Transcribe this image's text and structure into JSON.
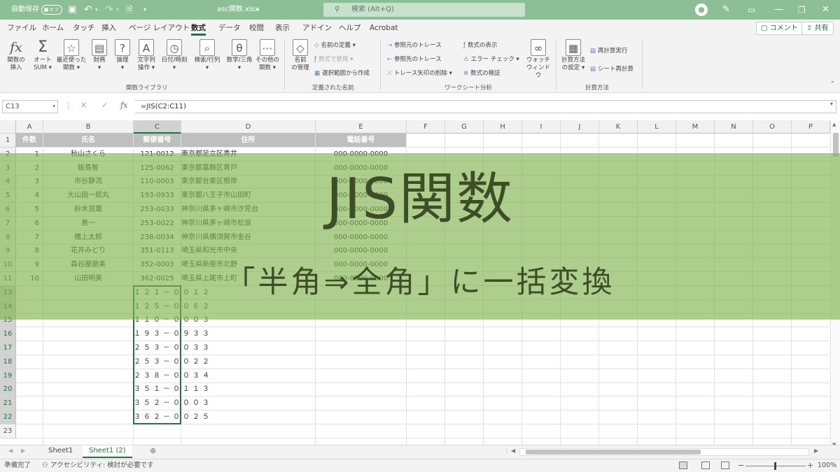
{
  "titlebar": {
    "autosave_label": "自動保存",
    "autosave_state": "オフ",
    "filename": "asc関数.xlsx",
    "search_placeholder": "検索 (Alt+Q)"
  },
  "menu": [
    "ファイル",
    "ホーム",
    "タッチ",
    "挿入",
    "ページ レイアウト",
    "数式",
    "データ",
    "校閲",
    "表示",
    "アドイン",
    "ヘルプ",
    "Acrobat"
  ],
  "menu_active": "数式",
  "comment_button": "コメント",
  "share_button": "共有",
  "ribbon": {
    "insert_function": [
      "関数の",
      "挿入"
    ],
    "autosum": [
      "オート",
      "SUM"
    ],
    "recent": [
      "最近使った",
      "関数"
    ],
    "financial": "財務",
    "logical": "論理",
    "text": [
      "文字列",
      "操作"
    ],
    "datetime": "日付/時刻",
    "lookup": "検索/行列",
    "math": "数学/三角",
    "more": [
      "その他の",
      "関数"
    ],
    "group_library": "関数ライブラリ",
    "name_manager": [
      "名前",
      "の管理"
    ],
    "define_name": "名前の定義",
    "use_in_formula": "数式で使用",
    "create_from_selection": "選択範囲から作成",
    "group_names": "定義された名前",
    "trace_precedents": "参照元のトレース",
    "trace_dependents": "参照先のトレース",
    "remove_arrows": "トレース矢印の削除",
    "show_formulas": "数式の表示",
    "error_check": "エラー チェック",
    "evaluate": "数式の検証",
    "watch": [
      "ウォッチ",
      "ウィンドウ"
    ],
    "group_audit": "ワークシート分析",
    "calc_options": [
      "計算方法",
      "の設定"
    ],
    "calc_now": "再計算実行",
    "calc_sheet": "シート再計算",
    "group_calc": "計算方法"
  },
  "formula_bar": {
    "name_box": "C13",
    "formula": "=JIS(C2:C11)"
  },
  "columns": [
    "A",
    "B",
    "C",
    "D",
    "E",
    "F",
    "G",
    "H",
    "I",
    "J",
    "K",
    "L",
    "M",
    "N",
    "O",
    "P"
  ],
  "rows": [
    "1",
    "2",
    "3",
    "4",
    "5",
    "6",
    "7",
    "8",
    "9",
    "10",
    "11",
    "13",
    "14",
    "15",
    "16",
    "17",
    "18",
    "19",
    "20",
    "21",
    "22",
    "23"
  ],
  "table_headers": [
    "件数",
    "氏名",
    "郵便番号",
    "住所",
    "電話番号"
  ],
  "table_rows": [
    [
      "1",
      "秋山さくら",
      "121-0012",
      "東京都足立区青井",
      "000-0000-0000"
    ],
    [
      "2",
      "飯島智",
      "125-0062",
      "東京都葛飾区青戸",
      "000-0000-0000"
    ],
    [
      "3",
      "市谷静流",
      "110-0003",
      "東京都台東区根岸",
      "000-0000-0000"
    ],
    [
      "4",
      "大山田一郎丸",
      "193-0933",
      "東京都八王子市山田町",
      "000-0000-0000"
    ],
    [
      "5",
      "鈴木双葉",
      "253-0033",
      "神奈川県茅ヶ崎市汐見台",
      "000-0000-0000"
    ],
    [
      "6",
      "貴一",
      "253-0022",
      "神奈川県茅ヶ崎市松浪",
      "000-0000-0000"
    ],
    [
      "7",
      "橋上太郎",
      "238-0034",
      "神奈川県横須賀市金谷",
      "000-0000-0000"
    ],
    [
      "8",
      "花井みどり",
      "351-0113",
      "埼玉県和光市中央",
      "000-0000-0000"
    ],
    [
      "9",
      "森谷屋朋美",
      "352-0003",
      "埼玉県新座市北野",
      "000-0000-0000"
    ],
    [
      "10",
      "山田明美",
      "362-0025",
      "埼玉県上尾市上町",
      "000-0000-0000"
    ]
  ],
  "converted": [
    "１２１－００１２",
    "１２５－００６２",
    "１１０－０００３",
    "１９３－０９３３",
    "２５３－００３３",
    "２５３－００２２",
    "２３８－００３４",
    "３５１－０１１３",
    "３５２－０００３",
    "３６２－００２５"
  ],
  "sheets": [
    "Sheet1",
    "Sheet1 (2)"
  ],
  "active_sheet": "Sheet1 (2)",
  "status": {
    "ready": "準備完了",
    "accessibility": "アクセシビリティ: 検討が必要です",
    "zoom": "100%"
  },
  "banner": {
    "title": "JIS関数",
    "subtitle": "「半角⇒全角」に一括変換"
  },
  "colors": {
    "accent": "#217346",
    "titlebar": "#8cbf96",
    "banner": "#7fb24c",
    "banner_text": "#3d4e27"
  }
}
